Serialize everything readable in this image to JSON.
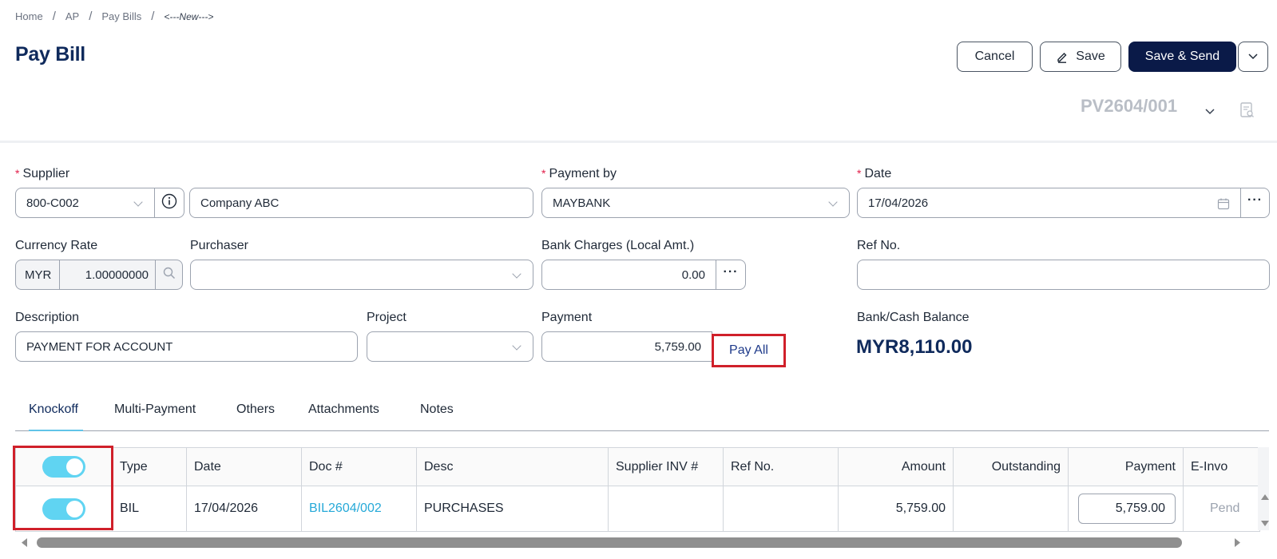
{
  "breadcrumb": {
    "home": "Home",
    "ap": "AP",
    "pay_bills": "Pay Bills",
    "current": "<---New--->"
  },
  "page": {
    "title": "Pay Bill",
    "doc_number": "PV2604/001"
  },
  "actions": {
    "cancel": "Cancel",
    "save": "Save",
    "save_send": "Save & Send"
  },
  "form": {
    "supplier": {
      "label": "Supplier",
      "code": "800-C002",
      "name": "Company ABC"
    },
    "payment_by": {
      "label": "Payment by",
      "value": "MAYBANK"
    },
    "date": {
      "label": "Date",
      "value": "17/04/2026"
    },
    "currency_rate": {
      "label": "Currency Rate",
      "currency": "MYR",
      "rate": "1.00000000"
    },
    "purchaser": {
      "label": "Purchaser",
      "value": ""
    },
    "bank_charges": {
      "label": "Bank Charges (Local Amt.)",
      "value": "0.00"
    },
    "ref_no": {
      "label": "Ref No.",
      "value": ""
    },
    "description": {
      "label": "Description",
      "value": "PAYMENT FOR ACCOUNT"
    },
    "project": {
      "label": "Project",
      "value": ""
    },
    "payment": {
      "label": "Payment",
      "value": "5,759.00",
      "pay_all": "Pay All"
    },
    "balance": {
      "label": "Bank/Cash Balance",
      "value": "MYR8,110.00"
    }
  },
  "tabs": [
    "Knockoff",
    "Multi-Payment",
    "Others",
    "Attachments",
    "Notes"
  ],
  "table": {
    "headers": [
      "Type",
      "Date",
      "Doc #",
      "Desc",
      "Supplier INV #",
      "Ref No.",
      "Amount",
      "Outstanding",
      "Payment",
      "E-Invo"
    ],
    "rows": [
      {
        "type": "BIL",
        "date": "17/04/2026",
        "doc": "BIL2604/002",
        "desc": "PURCHASES",
        "supplier_inv": "",
        "ref": "",
        "amount": "5,759.00",
        "outstanding": "",
        "payment": "5,759.00",
        "einvoice": "Pend"
      }
    ]
  },
  "colors": {
    "primary": "#0a1a48",
    "title": "#0f2a5c",
    "accent": "#60d4f2",
    "link": "#26a9d8",
    "highlight": "#d0202a"
  }
}
